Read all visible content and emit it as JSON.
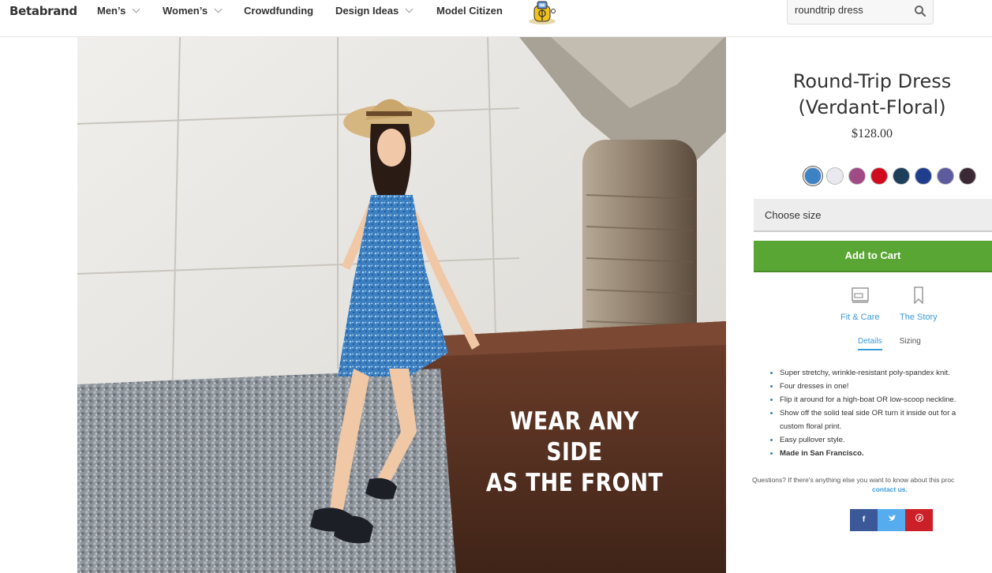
{
  "header": {
    "logo": "Betabrand",
    "nav": [
      {
        "label": "Men’s",
        "has_dropdown": true
      },
      {
        "label": "Women’s",
        "has_dropdown": true
      },
      {
        "label": "Crowdfunding",
        "has_dropdown": false
      },
      {
        "label": "Design Ideas",
        "has_dropdown": true
      },
      {
        "label": "Model Citizen",
        "has_dropdown": false
      }
    ],
    "search": {
      "value": "roundtrip dress",
      "icon": "search-icon"
    }
  },
  "hero": {
    "overlay_line1": "WEAR ANY SIDE",
    "overlay_line2": "AS THE FRONT"
  },
  "product": {
    "title_line1": "Round-Trip Dress",
    "title_line2": "(Verdant-Floral)",
    "price": "$128.00",
    "swatch_colors": [
      "#3b83c4",
      "#e8e8ee",
      "#a04a86",
      "#d10b1e",
      "#1d3f5a",
      "#1e3d8c",
      "#5c5b9e",
      "#3b2a35"
    ],
    "selected_swatch": 0,
    "size_placeholder": "Choose size",
    "add_to_cart": "Add to Cart",
    "actions": [
      {
        "label": "Fit & Care",
        "icon": "sewing-machine-icon"
      },
      {
        "label": "The Story",
        "icon": "bookmark-icon"
      }
    ],
    "tabs": [
      {
        "label": "Details",
        "active": true
      },
      {
        "label": "Sizing",
        "active": false
      }
    ],
    "details": [
      "Super stretchy, wrinkle-resistant poly-spandex knit.",
      "Four dresses in one!",
      "Flip it around for a high-boat OR low-scoop neckline.",
      "Show off the solid teal side OR turn it inside out for a",
      "custom floral print.",
      "Easy pullover style.",
      "Made in San Francisco."
    ],
    "questions": "Questions? If there's anything else you want to know about this proc",
    "contact_link": "contact us.",
    "share": [
      {
        "label": "f",
        "color": "#3b5998"
      },
      {
        "label": "t",
        "color": "#55acee"
      },
      {
        "label": "p",
        "color": "#cb2027"
      }
    ]
  },
  "colors": {
    "accent": "#3a9bd9",
    "cart_green": "#5aa634"
  }
}
